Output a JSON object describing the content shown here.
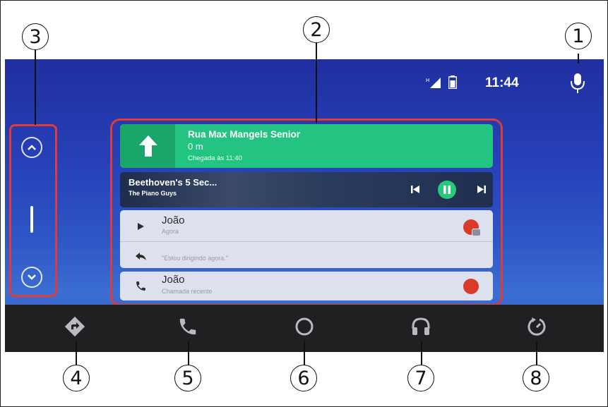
{
  "callouts": [
    "1",
    "2",
    "3",
    "4",
    "5",
    "6",
    "7",
    "8"
  ],
  "status": {
    "time": "11:44"
  },
  "navigation": {
    "street": "Rua Max Mangels Senior",
    "distance": "0 m",
    "arrival": "Chegada às 11:40"
  },
  "media": {
    "title": "Beethoven's 5 Sec...",
    "artist": "The Piano Guys"
  },
  "message": {
    "contact": "João",
    "time": "Agora",
    "preview": "\"Estou dirigindo agora.\""
  },
  "call": {
    "contact": "João",
    "status": "Chamada recente"
  },
  "bottom_nav": [
    "navigation-icon",
    "phone-icon",
    "home-icon",
    "audio-icon",
    "return-icon"
  ],
  "colors": {
    "highlight": "#e03a3a",
    "nav_green": "#23c481",
    "bar": "#202022"
  }
}
